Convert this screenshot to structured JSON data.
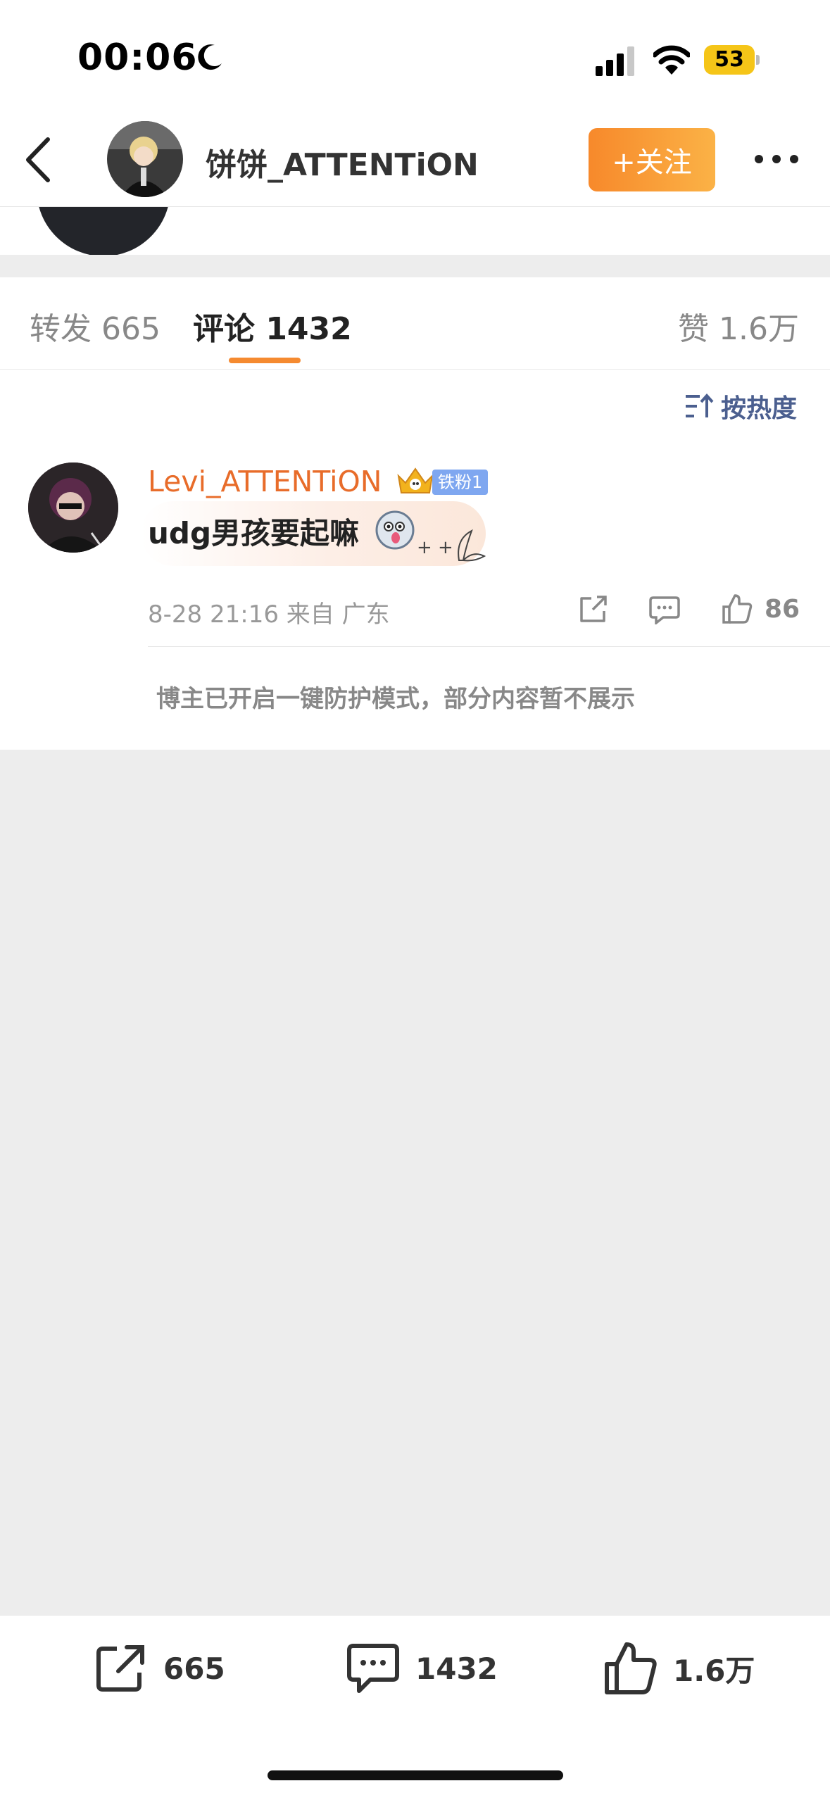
{
  "status_bar": {
    "time": "00:06",
    "battery": "53"
  },
  "header": {
    "title": "饼饼_ATTENTiON",
    "follow_label": "+关注"
  },
  "tabs": {
    "repost": "转发 665",
    "comments": "评论 1432",
    "likes": "赞 1.6万"
  },
  "sort": {
    "label": "按热度"
  },
  "comment": {
    "username": "Levi_ATTENTiON",
    "badge": "铁粉1",
    "text": "udg男孩要起嘛",
    "meta": "8-28 21:16 来自 广东",
    "like_count": "86"
  },
  "notice": "博主已开启一键防护模式，部分内容暂不展示",
  "bottom_bar": {
    "repost_count": "665",
    "comment_count": "1432",
    "like_count": "1.6万"
  },
  "colors": {
    "accent": "#f58a30",
    "username": "#e86c2a",
    "link_blue": "#4b5f8f",
    "badge": "#7fa7f0"
  }
}
